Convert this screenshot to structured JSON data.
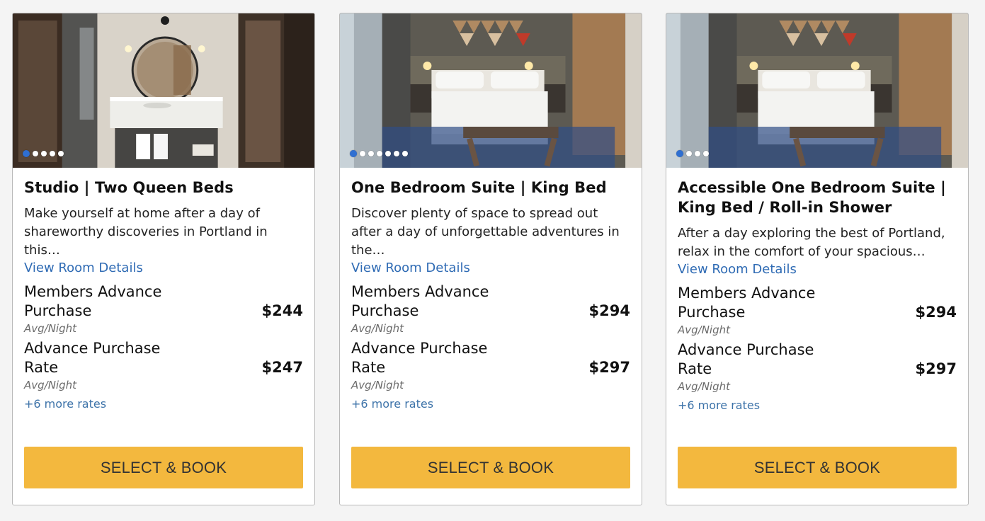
{
  "rooms": [
    {
      "title": "Studio | Two Queen Beds",
      "description": "Make yourself at home after a day of shareworthy discoveries in Portland in this…",
      "details_link": "View Room Details",
      "photo": "bathroom-vanity-photo",
      "carousel_dots": 5,
      "rates": [
        {
          "name": "Members Advance Purchase",
          "price": "$244",
          "unit": "Avg/Night"
        },
        {
          "name": "Advance Purchase Rate",
          "price": "$247",
          "unit": "Avg/Night"
        }
      ],
      "more_rates": "+6 more rates",
      "button": "SELECT & BOOK"
    },
    {
      "title": "One Bedroom Suite | King Bed",
      "description": "Discover plenty of space to spread out after a day of unforgettable adventures in the…",
      "details_link": "View Room Details",
      "photo": "king-bedroom-photo",
      "carousel_dots": 7,
      "rates": [
        {
          "name": "Members Advance Purchase",
          "price": "$294",
          "unit": "Avg/Night"
        },
        {
          "name": "Advance Purchase Rate",
          "price": "$297",
          "unit": "Avg/Night"
        }
      ],
      "more_rates": "+6 more rates",
      "button": "SELECT & BOOK"
    },
    {
      "title": "Accessible One Bedroom Suite | King Bed / Roll-in Shower",
      "description": "After a day exploring the best of Portland, relax in the comfort of your spacious…",
      "details_link": "View Room Details",
      "photo": "king-bedroom-photo",
      "carousel_dots": 4,
      "rates": [
        {
          "name": "Members Advance Purchase",
          "price": "$294",
          "unit": "Avg/Night"
        },
        {
          "name": "Advance Purchase Rate",
          "price": "$297",
          "unit": "Avg/Night"
        }
      ],
      "more_rates": "+6 more rates",
      "button": "SELECT & BOOK"
    }
  ],
  "colors": {
    "button": "#f3b83e",
    "link": "#2f6bb4",
    "active_dot": "#2f6fd1"
  }
}
